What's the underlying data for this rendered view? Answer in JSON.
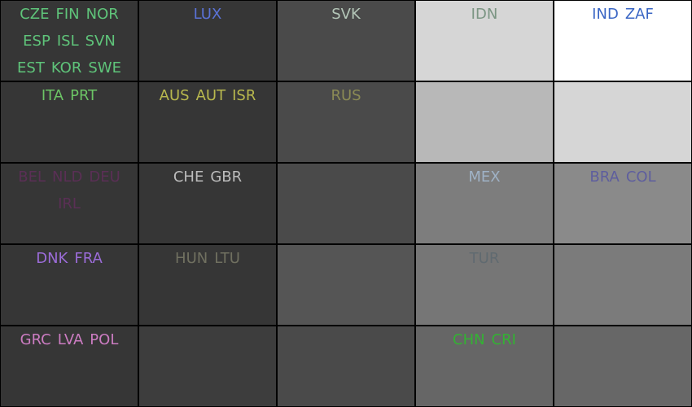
{
  "chart_data": {
    "type": "heatmap",
    "title": "",
    "xlabel": "",
    "ylabel": "",
    "rows": 5,
    "cols": 5,
    "cells": [
      [
        {
          "shade": "#363636",
          "color": "#5fc47a",
          "labels": [
            "CZE",
            "FIN",
            "NOR",
            "ESP",
            "ISL",
            "SVN",
            "EST",
            "KOR",
            "SWE"
          ]
        },
        {
          "shade": "#363636",
          "color": "#5a72d6",
          "labels": [
            "LUX"
          ]
        },
        {
          "shade": "#4a4a4a",
          "color": "#b4c6b8",
          "labels": [
            "SVK"
          ]
        },
        {
          "shade": "#d6d6d6",
          "color": "#7b9583",
          "labels": [
            "IDN"
          ]
        },
        {
          "shade": "#ffffff",
          "color": "#3a66c4",
          "labels": [
            "IND",
            "ZAF"
          ]
        }
      ],
      [
        {
          "shade": "#363636",
          "color": "#6cc465",
          "labels": [
            "ITA",
            "PRT"
          ]
        },
        {
          "shade": "#363636",
          "color": "#b8b84e",
          "labels": [
            "AUS",
            "AUT",
            "ISR"
          ]
        },
        {
          "shade": "#4a4a4a",
          "color": "#8b8b55",
          "labels": [
            "RUS"
          ]
        },
        {
          "shade": "#b8b8b8",
          "color": "",
          "labels": []
        },
        {
          "shade": "#d6d6d6",
          "color": "",
          "labels": []
        }
      ],
      [
        {
          "shade": "#363636",
          "color": "#5a2f55",
          "labels": [
            "BEL",
            "NLD",
            "DEU",
            "IRL"
          ]
        },
        {
          "shade": "#363636",
          "color": "#bcbcbc",
          "labels": [
            "CHE",
            "GBR"
          ]
        },
        {
          "shade": "#4a4a4a",
          "color": "",
          "labels": []
        },
        {
          "shade": "#7d7d7d",
          "color": "#9fb2c6",
          "labels": [
            "MEX"
          ]
        },
        {
          "shade": "#8a8a8a",
          "color": "#5e5e9e",
          "labels": [
            "BRA",
            "COL"
          ]
        }
      ],
      [
        {
          "shade": "#363636",
          "color": "#9b6cd8",
          "labels": [
            "DNK",
            "FRA"
          ]
        },
        {
          "shade": "#363636",
          "color": "#707060",
          "labels": [
            "HUN",
            "LTU"
          ]
        },
        {
          "shade": "#555555",
          "color": "",
          "labels": []
        },
        {
          "shade": "#767676",
          "color": "#606a70",
          "labels": [
            "TUR"
          ]
        },
        {
          "shade": "#7b7b7b",
          "color": "",
          "labels": []
        }
      ],
      [
        {
          "shade": "#363636",
          "color": "#cc7cc2",
          "labels": [
            "GRC",
            "LVA",
            "POL"
          ]
        },
        {
          "shade": "#3d3d3d",
          "color": "",
          "labels": []
        },
        {
          "shade": "#4a4a4a",
          "color": "",
          "labels": []
        },
        {
          "shade": "#666666",
          "color": "#33b233",
          "labels": [
            "CHN",
            "CRI"
          ]
        },
        {
          "shade": "#676767",
          "color": "",
          "labels": []
        }
      ]
    ]
  }
}
